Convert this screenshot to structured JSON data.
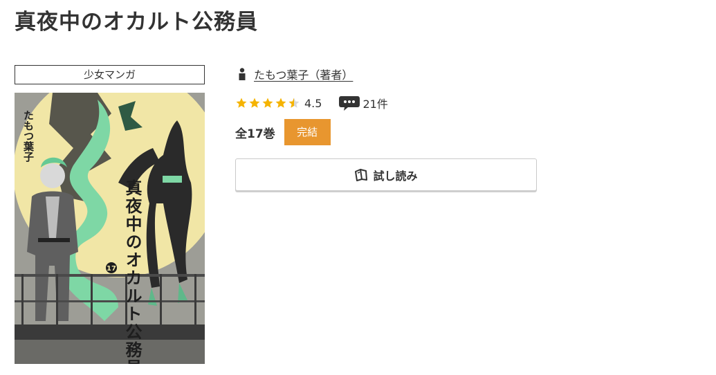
{
  "book": {
    "title": "真夜中のオカルト公務員",
    "genre": "少女マンガ",
    "author": "たもつ葉子（著者）",
    "rating": "4.5",
    "rating_stars": 4.5,
    "review_count": "21件",
    "volume_count": "全17巻",
    "status": "完結",
    "trial_label": "試し読み"
  },
  "cover": {
    "author_text": "たもつ葉子",
    "title_text": "真夜中のオカルト公務員",
    "volume_number": "17"
  },
  "colors": {
    "star": "#f5b301",
    "status_badge": "#e8962f",
    "text": "#333333",
    "cover_moon": "#f1e6a6",
    "cover_green": "#7ed7a5"
  },
  "icons": {
    "author": "person-icon",
    "reviews": "speech-bubble-icon",
    "trial": "open-book-icon",
    "rating": "star-icon"
  }
}
